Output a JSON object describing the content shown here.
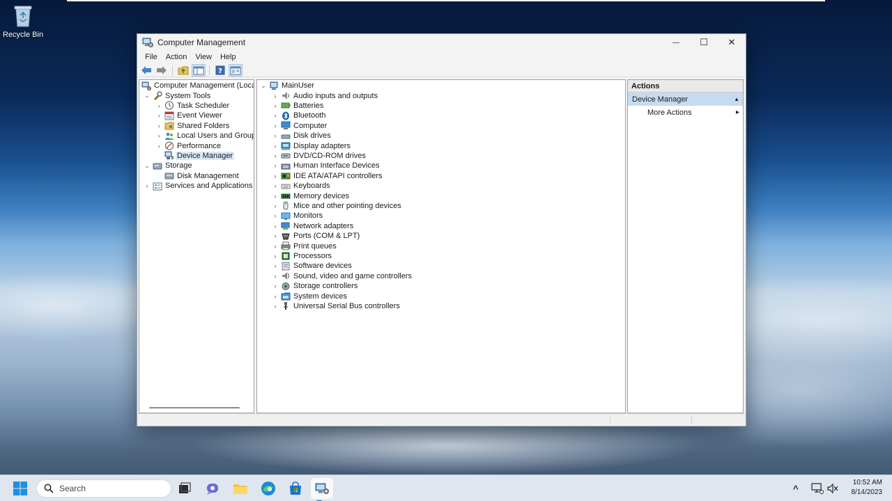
{
  "desktop": {
    "recycle_bin_label": "Recycle Bin"
  },
  "window": {
    "title": "Computer Management",
    "controls": {
      "minimize": "—",
      "maximize": "☐",
      "close": "✕"
    }
  },
  "menu": [
    "File",
    "Action",
    "View",
    "Help"
  ],
  "toolbar": {
    "buttons": [
      "back-icon",
      "forward-icon",
      "up-folder-icon",
      "show-hide-console-tree-icon",
      "help-icon",
      "properties-icon"
    ]
  },
  "left_tree": {
    "items": [
      {
        "label": "Computer Management (Local",
        "level": 0,
        "chevron": "",
        "icon": "computer-management-icon"
      },
      {
        "label": "System Tools",
        "level": 1,
        "chevron": "⌄",
        "icon": "tools-icon"
      },
      {
        "label": "Task Scheduler",
        "level": 2,
        "chevron": "›",
        "icon": "clock-icon"
      },
      {
        "label": "Event Viewer",
        "level": 2,
        "chevron": "›",
        "icon": "event-viewer-icon"
      },
      {
        "label": "Shared Folders",
        "level": 2,
        "chevron": "›",
        "icon": "shared-folder-icon"
      },
      {
        "label": "Local Users and Groups",
        "level": 2,
        "chevron": "›",
        "icon": "users-icon"
      },
      {
        "label": "Performance",
        "level": 2,
        "chevron": "›",
        "icon": "performance-icon"
      },
      {
        "label": "Device Manager",
        "level": 2,
        "chevron": "",
        "icon": "device-manager-icon",
        "selected": true
      },
      {
        "label": "Storage",
        "level": 1,
        "chevron": "⌄",
        "icon": "storage-icon"
      },
      {
        "label": "Disk Management",
        "level": 2,
        "chevron": "",
        "icon": "disk-management-icon"
      },
      {
        "label": "Services and Applications",
        "level": 1,
        "chevron": "›",
        "icon": "services-icon"
      }
    ]
  },
  "device_tree": {
    "root": "MainUser",
    "categories": [
      {
        "label": "Audio inputs and outputs",
        "icon": "audio-icon"
      },
      {
        "label": "Batteries",
        "icon": "battery-icon"
      },
      {
        "label": "Bluetooth",
        "icon": "bluetooth-icon"
      },
      {
        "label": "Computer",
        "icon": "computer-icon"
      },
      {
        "label": "Disk drives",
        "icon": "disk-drive-icon"
      },
      {
        "label": "Display adapters",
        "icon": "display-adapter-icon"
      },
      {
        "label": "DVD/CD-ROM drives",
        "icon": "dvd-icon"
      },
      {
        "label": "Human Interface Devices",
        "icon": "hid-icon"
      },
      {
        "label": "IDE ATA/ATAPI controllers",
        "icon": "ide-controller-icon"
      },
      {
        "label": "Keyboards",
        "icon": "keyboard-icon"
      },
      {
        "label": "Memory devices",
        "icon": "memory-icon"
      },
      {
        "label": "Mice and other pointing devices",
        "icon": "mouse-icon"
      },
      {
        "label": "Monitors",
        "icon": "monitor-icon"
      },
      {
        "label": "Network adapters",
        "icon": "network-adapter-icon"
      },
      {
        "label": "Ports (COM & LPT)",
        "icon": "port-icon"
      },
      {
        "label": "Print queues",
        "icon": "printer-icon"
      },
      {
        "label": "Processors",
        "icon": "processor-icon"
      },
      {
        "label": "Software devices",
        "icon": "software-device-icon"
      },
      {
        "label": "Sound, video and game controllers",
        "icon": "sound-icon"
      },
      {
        "label": "Storage controllers",
        "icon": "storage-controller-icon"
      },
      {
        "label": "System devices",
        "icon": "system-devices-icon"
      },
      {
        "label": "Universal Serial Bus controllers",
        "icon": "usb-icon"
      }
    ]
  },
  "actions_pane": {
    "header": "Actions",
    "section": "Device Manager",
    "section_toggle": "▲",
    "items": [
      {
        "label": "More Actions",
        "arrow": "▸"
      }
    ]
  },
  "taskbar": {
    "search_placeholder": "Search",
    "clock_time": "10:52 AM",
    "clock_date": "8/14/2023",
    "tray_chevron": "^"
  },
  "colors": {
    "accent": "#0067c0",
    "selection": "#d9e8f7",
    "actions_section": "#c7dbf0"
  }
}
